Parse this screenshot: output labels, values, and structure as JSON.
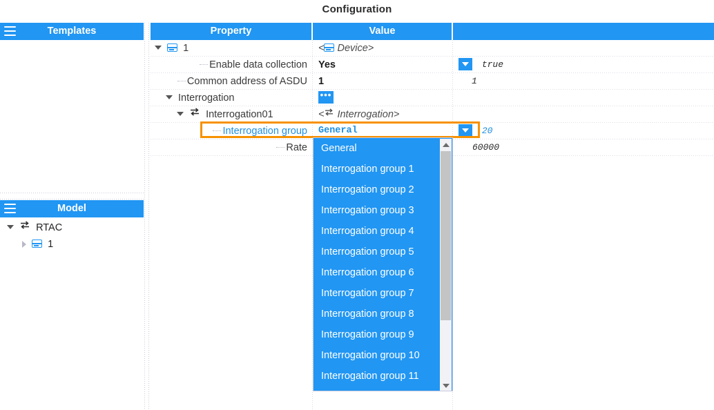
{
  "page": {
    "title": "Configuration"
  },
  "panels": {
    "templates": {
      "title": "Templates",
      "menu_icon": "hamburger-icon"
    },
    "model": {
      "title": "Model",
      "menu_icon": "hamburger-icon",
      "tree": [
        {
          "label": "RTAC",
          "icon": "swap-arrows-icon",
          "expanded": true,
          "indent": 0
        },
        {
          "label": "1",
          "icon": "device-icon",
          "expanded": false,
          "indent": 1
        }
      ]
    }
  },
  "grid": {
    "columns": [
      "Property",
      "Value",
      ""
    ],
    "rows": [
      {
        "property": "1",
        "icon": "device-icon",
        "twisty": "open",
        "indent": 0,
        "value": "<Device>",
        "value_style": "italic-gray",
        "value_icon": "device-icon",
        "extra": ""
      },
      {
        "property": "Enable data collection",
        "icon": "",
        "twisty": "leaf",
        "indent": 1,
        "value": "Yes",
        "value_style": "bold",
        "value_icon": "",
        "extra": "true",
        "extra_widget": "combo-button"
      },
      {
        "property": "Common address of ASDU",
        "icon": "",
        "twisty": "leaf",
        "indent": 1,
        "value": "1",
        "value_style": "bold",
        "value_icon": "",
        "extra": "1"
      },
      {
        "property": "Interrogation",
        "icon": "",
        "twisty": "open",
        "indent": 1,
        "value": "",
        "value_style": "",
        "value_icon": "",
        "value_widget": "ellipsis-button",
        "extra": ""
      },
      {
        "property": "Interrogation01",
        "icon": "swap-arrows-icon",
        "twisty": "open",
        "indent": 2,
        "value": "<Interrogation>",
        "value_style": "italic-gray",
        "value_icon": "swap-arrows-icon",
        "extra": ""
      },
      {
        "property": "Interrogation group",
        "icon": "",
        "twisty": "leaf",
        "indent": 3,
        "property_style": "link",
        "selected": true,
        "value": "General",
        "value_style": "mono-blue-bold",
        "value_icon": "",
        "extra": "20",
        "extra_widget": "combo-button"
      },
      {
        "property": "Rate",
        "icon": "",
        "twisty": "leaf",
        "indent": 3,
        "value": "",
        "value_style": "",
        "value_icon": "",
        "extra": "60000"
      }
    ]
  },
  "dropdown": {
    "open": true,
    "selected": "General",
    "options": [
      "General",
      "Interrogation group 1",
      "Interrogation group 2",
      "Interrogation group 3",
      "Interrogation group 4",
      "Interrogation group 5",
      "Interrogation group 6",
      "Interrogation group 7",
      "Interrogation group 8",
      "Interrogation group 9",
      "Interrogation group 10",
      "Interrogation group 11"
    ],
    "scroll_up_icon": "caret-up-icon",
    "scroll_down_icon": "caret-down-icon"
  },
  "colors": {
    "header_blue": "#2196f3",
    "selection_orange": "#f79100",
    "link_blue": "#1f8fe0"
  }
}
